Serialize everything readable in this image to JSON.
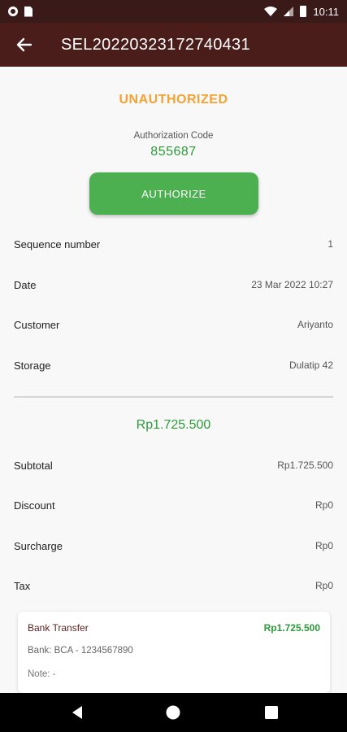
{
  "status_bar": {
    "time": "10:11"
  },
  "header": {
    "title": "SEL20220323172740431"
  },
  "authorization": {
    "status": "UNAUTHORIZED",
    "code_label": "Authorization Code",
    "code_value": "855687",
    "button_label": "AUTHORIZE"
  },
  "details": [
    {
      "label": "Sequence number",
      "value": "1"
    },
    {
      "label": "Date",
      "value": "23 Mar 2022 10:27"
    },
    {
      "label": "Customer",
      "value": "Ariyanto"
    },
    {
      "label": "Storage",
      "value": "Dulatip 42"
    }
  ],
  "total": "Rp1.725.500",
  "summary": [
    {
      "label": "Subtotal",
      "value": "Rp1.725.500"
    },
    {
      "label": "Discount",
      "value": "Rp0"
    },
    {
      "label": "Surcharge",
      "value": "Rp0"
    },
    {
      "label": "Tax",
      "value": "Rp0"
    }
  ],
  "payment": {
    "method": "Bank Transfer",
    "amount": "Rp1.725.500",
    "bank": "Bank: BCA - 1234567890",
    "note": "Note: -"
  },
  "colors": {
    "app_bar": "#4a1c1a",
    "status_bar": "#3a1a18",
    "status_warning": "#f3a233",
    "accent_green": "#2c9a3a",
    "button_green": "#4caf50"
  }
}
